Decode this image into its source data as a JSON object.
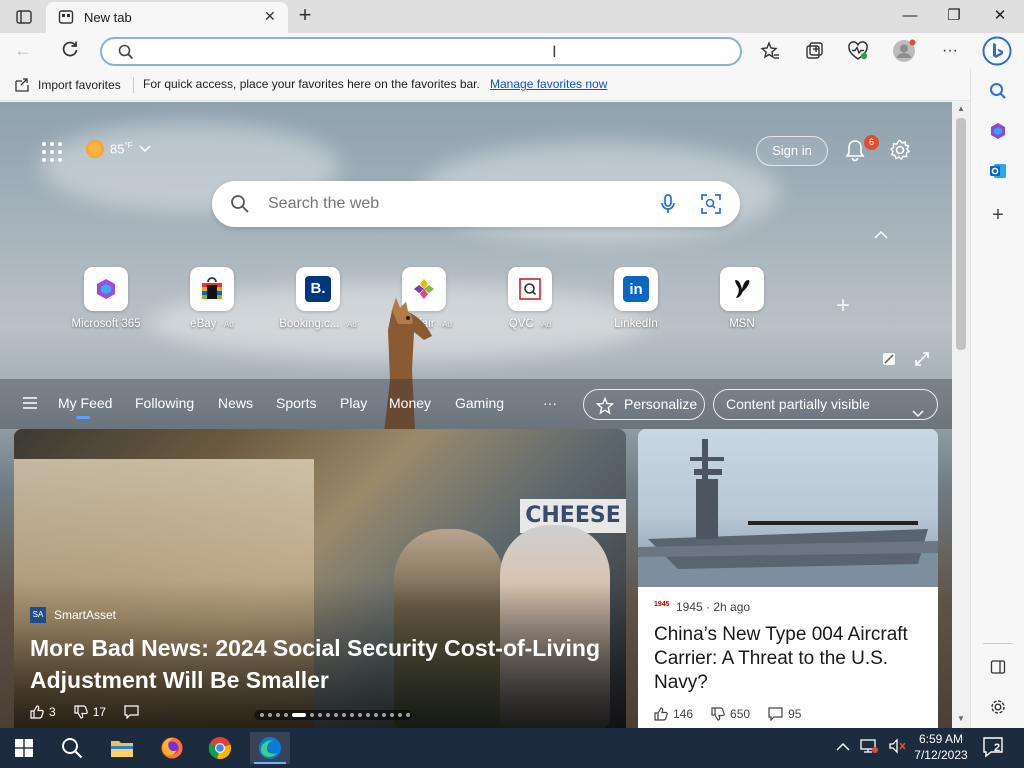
{
  "browser": {
    "tab_title": "New tab",
    "omnibox_value": "",
    "favorites_bar": {
      "import_label": "Import favorites",
      "hint": "For quick access, place your favorites here on the favorites bar.",
      "manage_link": "Manage favorites now"
    }
  },
  "page": {
    "weather": {
      "temp": "85",
      "unit": "°F"
    },
    "sign_in_label": "Sign in",
    "notification_count": "6",
    "search_placeholder": "Search the web",
    "quick_links": [
      {
        "label": "Microsoft 365",
        "ad": ""
      },
      {
        "label": "eBay",
        "ad": "· Ad"
      },
      {
        "label": "Booking.c...",
        "ad": "· Ad"
      },
      {
        "label": "Wayfair",
        "ad": "· Ad"
      },
      {
        "label": "QVC",
        "ad": "· Ad"
      },
      {
        "label": "LinkedIn",
        "ad": ""
      },
      {
        "label": "MSN",
        "ad": ""
      }
    ],
    "feed_tabs": [
      "My Feed",
      "Following",
      "News",
      "Sports",
      "Play",
      "Money",
      "Gaming"
    ],
    "more_label": "···",
    "personalize_label": "Personalize",
    "content_visibility": "Content partially visible",
    "main_story": {
      "source": "SmartAsset",
      "source_logo": "SA",
      "image_sign": "CHEESE",
      "headline": "More Bad News: 2024 Social Security Cost-of-Living Adjustment Will Be Smaller",
      "likes": "3",
      "dislikes": "17",
      "comments": ""
    },
    "side_story": {
      "source": "1945 · 2h ago",
      "source_logo": "1945",
      "headline": "China’s New Type 004 Aircraft Carrier: A Threat to the U.S. Navy?",
      "likes": "146",
      "dislikes": "650",
      "comments": "95"
    }
  },
  "taskbar": {
    "time": "6:59 AM",
    "date": "7/12/2023",
    "notifications": "2"
  },
  "colors": {
    "accent": "#0a58ca",
    "badge": "#e04c2c",
    "taskbar": "#1d2b3e"
  }
}
